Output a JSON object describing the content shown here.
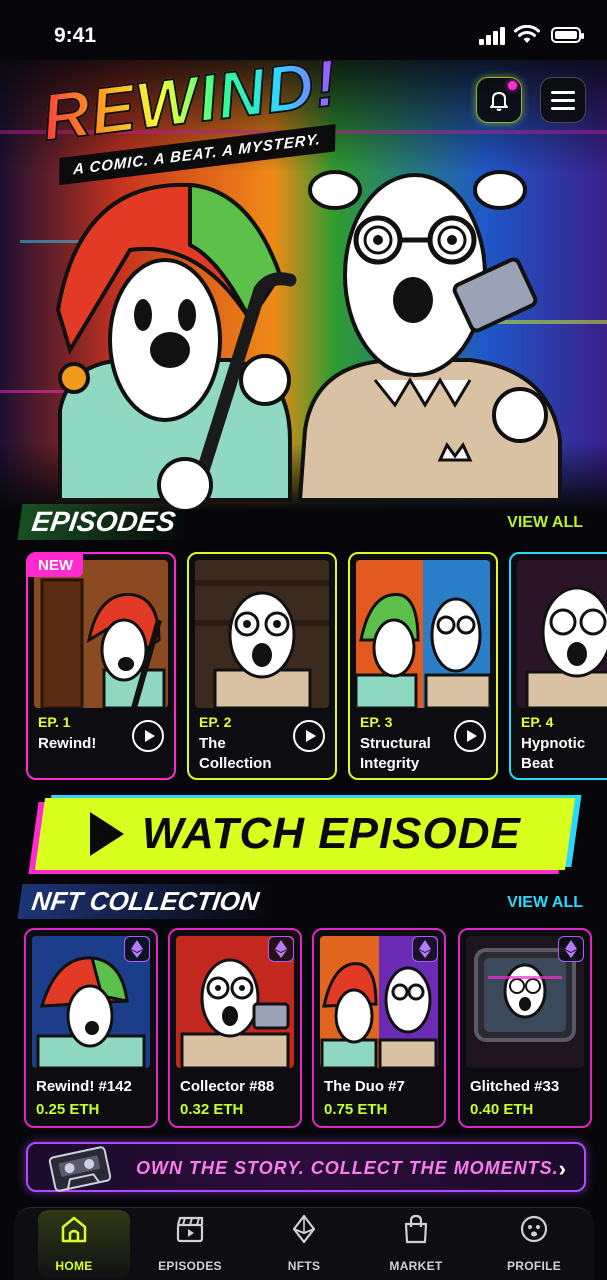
{
  "status_bar": {
    "time": "9:41"
  },
  "header": {
    "logo_title": "REWIND!",
    "tagline": "A COMIC. A BEAT. A MYSTERY."
  },
  "episodes": {
    "title": "EPISODES",
    "view_all": "VIEW ALL",
    "items": [
      {
        "number": "EP. 1",
        "name": "Rewind!",
        "badge": "NEW",
        "accent": "#ff2bd0"
      },
      {
        "number": "EP. 2",
        "name": "The Collection",
        "accent": "#d8ff1e"
      },
      {
        "number": "EP. 3",
        "name": "Structural Integrity",
        "accent": "#d8ff1e"
      },
      {
        "number": "EP. 4",
        "name": "Hypnotic Beat",
        "accent": "#2ad8ff"
      }
    ]
  },
  "watch_banner": {
    "label": "WATCH EPISODE"
  },
  "nft_collection": {
    "title": "NFT COLLECTION",
    "view_all": "VIEW ALL",
    "items": [
      {
        "name": "Rewind! #142",
        "price": "0.25 ETH"
      },
      {
        "name": "Collector #88",
        "price": "0.32 ETH"
      },
      {
        "name": "The Duo #7",
        "price": "0.75 ETH"
      },
      {
        "name": "Glitched #33",
        "price": "0.40 ETH"
      }
    ]
  },
  "promo_banner": {
    "text": "OWN THE STORY. COLLECT THE MOMENTS."
  },
  "bottom_nav": {
    "items": [
      {
        "label": "HOME",
        "icon": "home-icon",
        "active": true
      },
      {
        "label": "EPISODES",
        "icon": "clapperboard-icon"
      },
      {
        "label": "NFTS",
        "icon": "ethereum-icon"
      },
      {
        "label": "MARKET",
        "icon": "shopping-bag-icon"
      },
      {
        "label": "PROFILE",
        "icon": "face-icon"
      }
    ]
  },
  "colors": {
    "accent_lime": "#d8ff1e",
    "accent_pink": "#ff2bd0",
    "accent_cyan": "#2ad8ff",
    "accent_purple": "#b04bff",
    "background": "#07070b"
  }
}
